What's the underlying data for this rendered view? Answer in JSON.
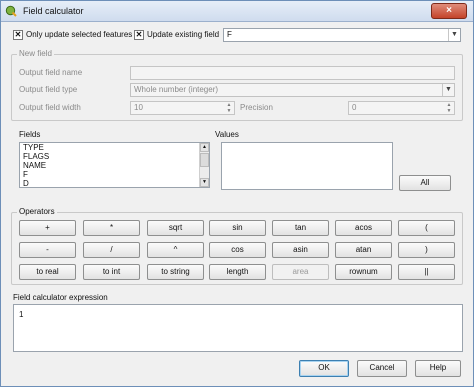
{
  "window": {
    "title": "Field calculator",
    "close_glyph": "×"
  },
  "top_options": {
    "only_update_selected": {
      "label": "Only update selected features",
      "checked": true
    },
    "update_existing": {
      "label": "Update existing field",
      "checked": true
    },
    "existing_field_value": "F"
  },
  "new_field": {
    "group_title": "New field",
    "output_name_label": "Output field name",
    "output_type_label": "Output field type",
    "output_type_value": "Whole number (integer)",
    "output_width_label": "Output field width",
    "output_width_value": "10",
    "precision_label": "Precision",
    "precision_value": "0"
  },
  "fields": {
    "label": "Fields",
    "items": [
      "TYPE",
      "FLAGS",
      "NAME",
      "F",
      "D"
    ]
  },
  "values": {
    "label": "Values",
    "all_button": "All"
  },
  "operators": {
    "group_title": "Operators",
    "rows": [
      [
        {
          "label": "+",
          "enabled": true
        },
        {
          "label": "*",
          "enabled": true
        },
        {
          "label": "sqrt",
          "enabled": true
        },
        {
          "label": "sin",
          "enabled": true
        },
        {
          "label": "tan",
          "enabled": true
        },
        {
          "label": "acos",
          "enabled": true
        },
        {
          "label": "(",
          "enabled": true
        }
      ],
      [
        {
          "label": "-",
          "enabled": true
        },
        {
          "label": "/",
          "enabled": true
        },
        {
          "label": "^",
          "enabled": true
        },
        {
          "label": "cos",
          "enabled": true
        },
        {
          "label": "asin",
          "enabled": true
        },
        {
          "label": "atan",
          "enabled": true
        },
        {
          "label": ")",
          "enabled": true
        }
      ],
      [
        {
          "label": "to real",
          "enabled": true
        },
        {
          "label": "to int",
          "enabled": true
        },
        {
          "label": "to string",
          "enabled": true
        },
        {
          "label": "length",
          "enabled": true
        },
        {
          "label": "area",
          "enabled": false
        },
        {
          "label": "rownum",
          "enabled": true
        },
        {
          "label": "||",
          "enabled": true
        }
      ]
    ]
  },
  "expression": {
    "label": "Field calculator expression",
    "value": "1"
  },
  "buttons": {
    "ok": "OK",
    "cancel": "Cancel",
    "help": "Help"
  },
  "icons": {
    "app": "qgis-logo-icon",
    "dropdown": "chevron-down-icon",
    "checkbox": "check-icon"
  }
}
